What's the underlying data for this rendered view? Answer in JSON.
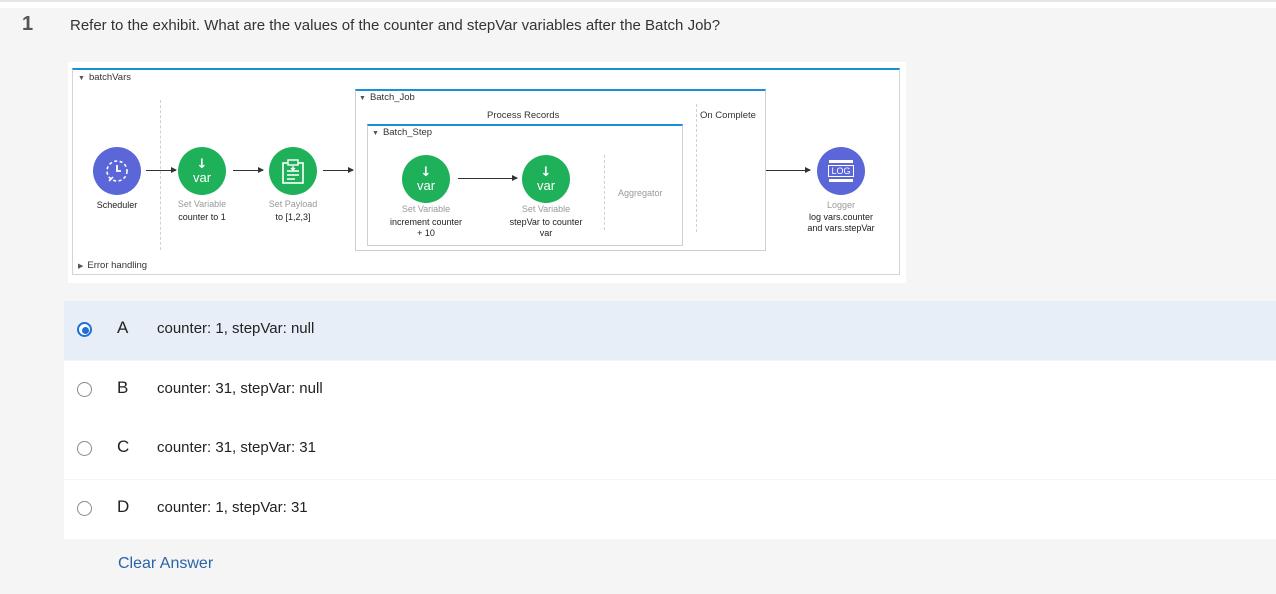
{
  "question": {
    "number": "1",
    "text": "Refer to the exhibit. What are the values of the counter and stepVar variables after the Batch Job?"
  },
  "exhibit": {
    "flow_name": "batchVars",
    "error_handling": "Error handling",
    "batch_job": "Batch_Job",
    "batch_step": "Batch_Step",
    "process_records": "Process Records",
    "on_complete": "On Complete",
    "aggregator": "Aggregator",
    "var_icon_label": "var",
    "logger_icon_label": "LOG",
    "scheduler": {
      "title": "Scheduler"
    },
    "set_var1": {
      "title": "Set Variable",
      "desc": "counter to 1"
    },
    "set_payload": {
      "title": "Set Payload",
      "desc": "to [1,2,3]"
    },
    "set_var2": {
      "title": "Set Variable",
      "desc_line1": "increment counter",
      "desc_line2": "+ 10"
    },
    "set_var3": {
      "title": "Set Variable",
      "desc_line1": "stepVar to counter",
      "desc_line2": "var"
    },
    "logger": {
      "title": "Logger",
      "desc_line1": "log vars.counter",
      "desc_line2": "and vars.stepVar"
    },
    "icons": [
      "scheduler-clock-icon",
      "set-variable-icon",
      "set-payload-icon",
      "logger-icon"
    ],
    "colors": {
      "green": "#1fb05a",
      "purple": "#5b67d8",
      "accent": "#1a8fd6"
    }
  },
  "answers": [
    {
      "letter": "A",
      "text": "counter: 1, stepVar: null",
      "selected": true
    },
    {
      "letter": "B",
      "text": "counter: 31, stepVar: null",
      "selected": false
    },
    {
      "letter": "C",
      "text": "counter: 31, stepVar: 31",
      "selected": false
    },
    {
      "letter": "D",
      "text": "counter: 1, stepVar: 31",
      "selected": false
    }
  ],
  "clear_answer": "Clear Answer",
  "colors": {
    "selected_bg": "#e8eef7",
    "radio_on": "#1f6fd6",
    "link": "#2a63a8"
  }
}
